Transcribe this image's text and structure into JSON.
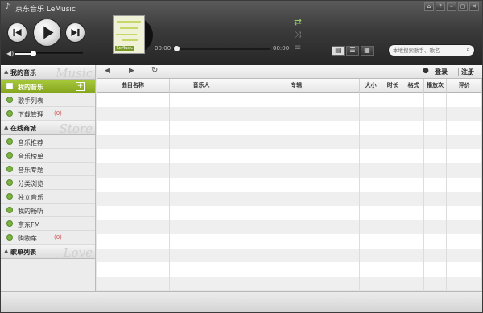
{
  "app": {
    "title": "京东音乐 LeMusic"
  },
  "window_controls": [
    {
      "name": "home-icon",
      "glyph": "⌂"
    },
    {
      "name": "help-icon",
      "glyph": "?"
    },
    {
      "name": "minimize-icon",
      "glyph": "–"
    },
    {
      "name": "restore-icon",
      "glyph": "▢"
    },
    {
      "name": "close-icon",
      "glyph": "✕"
    }
  ],
  "player": {
    "time_current": "00:00",
    "time_total": "00:00",
    "progress": 0.03,
    "volume": 0.26,
    "album_brand": "LeMusic"
  },
  "search": {
    "placeholder": "本地搜索歌手、歌名"
  },
  "sidebar": {
    "sections": [
      {
        "title": "我的音乐",
        "deco": "Music",
        "items": [
          {
            "label": "我的音乐",
            "active": true,
            "badge": ""
          },
          {
            "label": "歌手列表",
            "active": false,
            "badge": ""
          },
          {
            "label": "下载管理",
            "active": false,
            "badge": "(0)"
          }
        ]
      },
      {
        "title": "在线商城",
        "deco": "Store",
        "items": [
          {
            "label": "音乐推荐",
            "badge": ""
          },
          {
            "label": "音乐榜单",
            "badge": ""
          },
          {
            "label": "音乐专题",
            "badge": ""
          },
          {
            "label": "分类浏览",
            "badge": ""
          },
          {
            "label": "独立音乐",
            "badge": ""
          },
          {
            "label": "我的畅听",
            "badge": ""
          },
          {
            "label": "京东FM",
            "badge": ""
          },
          {
            "label": "购物车",
            "badge": "(0)"
          }
        ]
      },
      {
        "title": "歌单列表",
        "deco": "Love",
        "items": []
      }
    ]
  },
  "toolbar": {
    "back_glyph": "◀",
    "forward_glyph": "▶",
    "refresh_glyph": "↻",
    "login_label": "登录",
    "register_label": "注册"
  },
  "table": {
    "columns": [
      "曲目名称",
      "音乐人",
      "专辑",
      "大小",
      "时长",
      "格式",
      "播放次数",
      "评价"
    ],
    "row_count": 14
  },
  "colors": {
    "accent_green": "#8fb02a",
    "topbar_dark": "#2e2e2e"
  }
}
